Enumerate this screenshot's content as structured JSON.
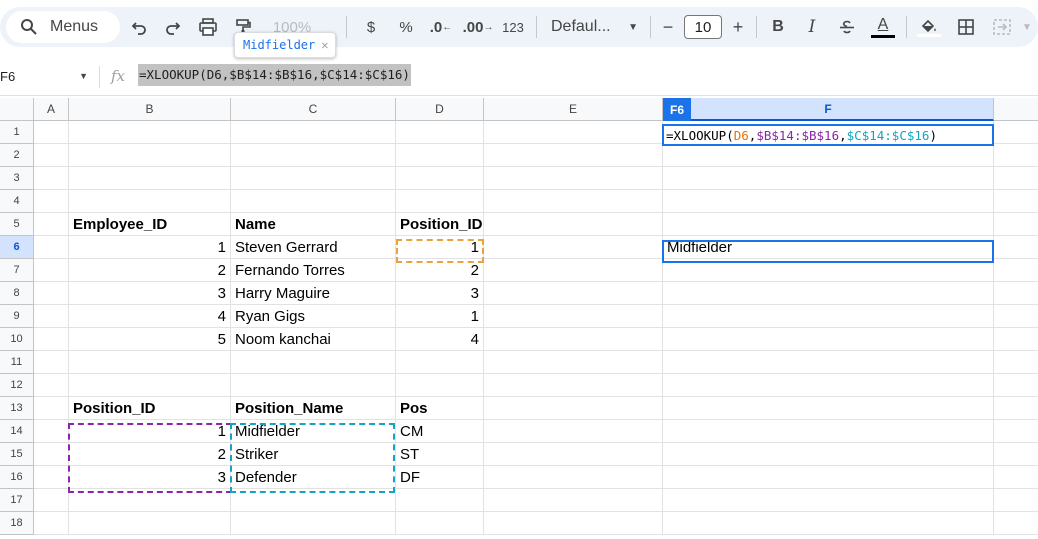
{
  "toolbar": {
    "menus_label": "Menus",
    "zoom_label": "100%",
    "currency_label": "$",
    "percent_label": "%",
    "decrease_decimal_label": ".0",
    "increase_decimal_label": ".00",
    "number_format_label": "123",
    "font_label": "Defaul...",
    "font_size": "10",
    "minus_label": "−",
    "plus_label": "+",
    "bold_label": "B",
    "italic_label": "I",
    "text_color_label": "A"
  },
  "chip": {
    "label": "Midfielder"
  },
  "formula_bar": {
    "name_box": "F6",
    "fx_label": "fx",
    "formula": "=XLOOKUP(D6,$B$14:$B$16,$C$14:$C$16)"
  },
  "editor": {
    "prefix": "=XLOOKUP(",
    "arg1": "D6",
    "comma1": ",",
    "arg2": "$B$14:$B$16",
    "comma2": ",",
    "arg3": "$C$14:$C$16",
    "suffix": ")",
    "arg1_color": "#e8710a",
    "arg2_color": "#8e24aa",
    "arg3_color": "#12a4c2"
  },
  "columns": [
    {
      "letter": "A"
    },
    {
      "letter": "B"
    },
    {
      "letter": "C"
    },
    {
      "letter": "D"
    },
    {
      "letter": "E"
    },
    {
      "letter": "F"
    }
  ],
  "selected_col_badge": "F6",
  "rows": [
    "1",
    "2",
    "3",
    "4",
    "5",
    "6",
    "7",
    "8",
    "9",
    "10",
    "11",
    "12",
    "13",
    "14",
    "15",
    "16",
    "17",
    "18"
  ],
  "cells": {
    "B5": "Employee_ID",
    "C5": "Name",
    "D5": "Position_ID",
    "B6": "1",
    "C6": "Steven Gerrard",
    "D6": "1",
    "B7": "2",
    "C7": "Fernando Torres",
    "D7": "2",
    "B8": "3",
    "C8": "Harry Maguire",
    "D8": "3",
    "B9": "4",
    "C9": "Ryan Gigs",
    "D9": "1",
    "B10": "5",
    "C10": "Noom kanchai",
    "D10": "4",
    "B13": "Position_ID",
    "C13": "Position_Name",
    "D13": "Pos",
    "B14": "1",
    "C14": "Midfielder",
    "D14": "CM",
    "B15": "2",
    "C15": "Striker",
    "D15": "ST",
    "B16": "3",
    "C16": "Defender",
    "D16": "DF",
    "F6": "Midfielder"
  },
  "colors": {
    "accent": "#1a73e8",
    "d6_range": "#e8a33a",
    "b_range": "#8e24aa",
    "c_range": "#12a4c2"
  }
}
